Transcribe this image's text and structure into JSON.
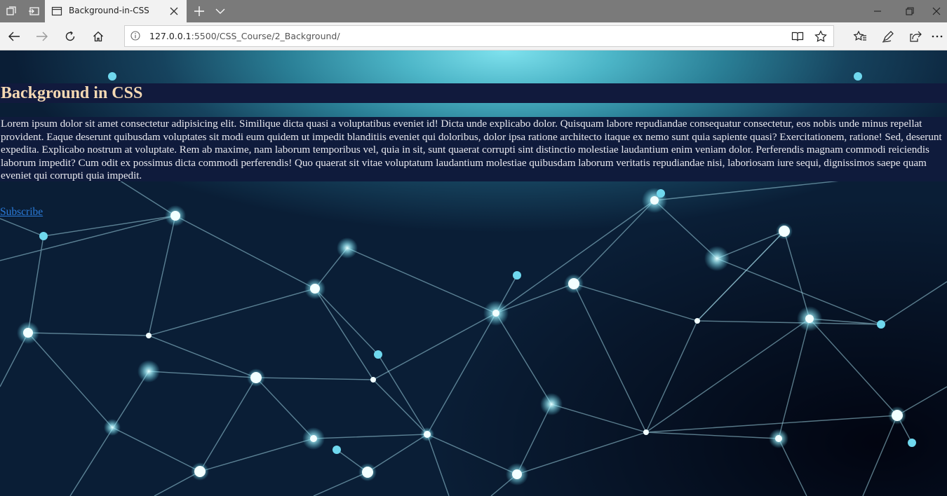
{
  "browser": {
    "tab": {
      "title": "Background-in-CSS"
    },
    "address": {
      "host": "127.0.0.1",
      "path": ":5500/CSS_Course/2_Background/"
    }
  },
  "page": {
    "heading": "Background in CSS",
    "paragraph": "Lorem ipsum dolor sit amet consectetur adipisicing elit. Similique dicta quasi a voluptatibus eveniet id! Dicta unde explicabo dolor. Quisquam labore repudiandae consequatur consectetur, eos nobis unde minus repellat provident. Eaque deserunt quibusdam voluptates sit modi eum quidem ut impedit blanditiis eveniet qui doloribus, dolor ipsa ratione architecto itaque ex nemo sunt quia sapiente quasi? Exercitationem, ratione! Sed, deserunt expedita. Explicabo nostrum at voluptate. Rem ab maxime, nam laborum temporibus vel, quia in sit, sunt quaerat corrupti sint distinctio molestiae laudantium enim veniam dolor. Perferendis magnam commodi reiciendis laborum impedit? Cum odit ex possimus dicta commodi perferendis! Quo quaerat sit vitae voluptatum laudantium molestiae quibusdam laborum veritatis repudiandae nisi, laboriosam iure sequi, dignissimos saepe quam eveniet qui corrupti quia impedit.",
    "link": "Subscribe"
  },
  "colors": {
    "heading_bg": "#111a3d",
    "heading_text": "#f5d9b3",
    "paragraph_bg": "#0f1b3c",
    "link": "#2a7ad8"
  },
  "icons": [
    "tab-preview-icon",
    "tab-aside-icon",
    "page-icon",
    "close-icon",
    "new-tab-icon",
    "chevron-down-icon",
    "minimize-icon",
    "restore-icon",
    "close-window-icon",
    "back-icon",
    "forward-icon",
    "refresh-icon",
    "home-icon",
    "info-icon",
    "reading-view-icon",
    "favorite-star-icon",
    "favorites-icon",
    "pen-icon",
    "share-icon",
    "more-icon"
  ]
}
